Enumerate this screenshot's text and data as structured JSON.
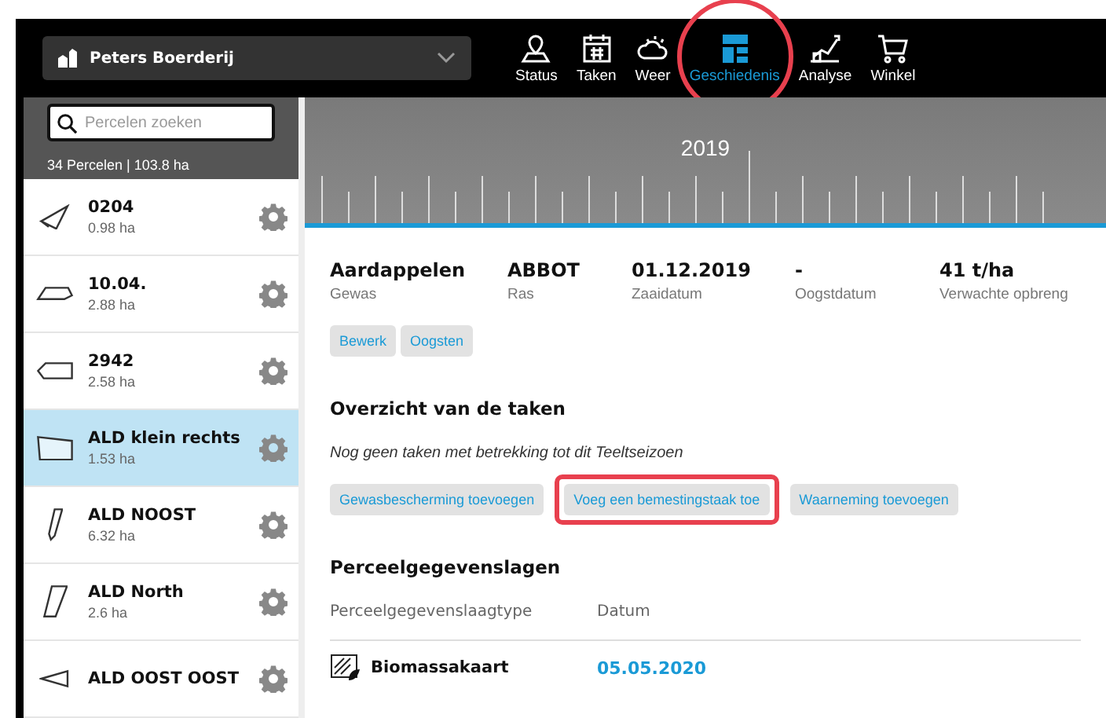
{
  "farm_selector": {
    "value": "Peters Boerderij"
  },
  "nav": [
    {
      "label": "Status",
      "selected": false,
      "highlighted": false
    },
    {
      "label": "Taken",
      "selected": false,
      "highlighted": false
    },
    {
      "label": "Weer",
      "selected": false,
      "highlighted": false
    },
    {
      "label": "Geschiedenis",
      "selected": true,
      "highlighted": true
    },
    {
      "label": "Analyse",
      "selected": false,
      "highlighted": false
    },
    {
      "label": "Winkel",
      "selected": false,
      "highlighted": false
    }
  ],
  "sidebar": {
    "search": {
      "placeholder": "Percelen zoeken"
    },
    "summary": "34 Percelen | 103.8 ha",
    "items": [
      {
        "name": "0204",
        "area": "0.98 ha",
        "selected": false
      },
      {
        "name": "10.04.",
        "area": "2.88 ha",
        "selected": false
      },
      {
        "name": "2942",
        "area": "2.58 ha",
        "selected": false
      },
      {
        "name": "ALD klein rechts",
        "area": "1.53 ha",
        "selected": true
      },
      {
        "name": "ALD NOOST",
        "area": "6.32 ha",
        "selected": false
      },
      {
        "name": "ALD North",
        "area": "2.6 ha",
        "selected": false
      },
      {
        "name": "ALD OOST OOST",
        "selected": false
      }
    ]
  },
  "timeline": {
    "year": "2019"
  },
  "crop": [
    {
      "value": "Aardappelen",
      "label": "Gewas"
    },
    {
      "value": "ABBOT",
      "label": "Ras"
    },
    {
      "value": "01.12.2019",
      "label": "Zaaidatum"
    },
    {
      "value": "-",
      "label": "Oogstdatum"
    },
    {
      "value": "41 t/ha",
      "label": "Verwachte opbreng"
    }
  ],
  "crop_actions": [
    {
      "label": "Bewerk"
    },
    {
      "label": "Oogsten"
    }
  ],
  "tasks": {
    "title": "Overzicht van de taken",
    "empty_text": "Nog geen taken met betrekking tot dit Teeltseizoen",
    "actions": [
      {
        "label": "Gewasbescherming toevoegen",
        "highlighted": false
      },
      {
        "label": "Voeg een bemestingstaak toe",
        "highlighted": true
      },
      {
        "label": "Waarneming toevoegen",
        "highlighted": false
      }
    ]
  },
  "layers": {
    "title": "Perceelgegevenslagen",
    "columns": [
      "Perceelgegevenslaagtype",
      "Datum"
    ],
    "rows": [
      {
        "type": "Biomassakaart",
        "date": "05.05.2020"
      }
    ]
  }
}
